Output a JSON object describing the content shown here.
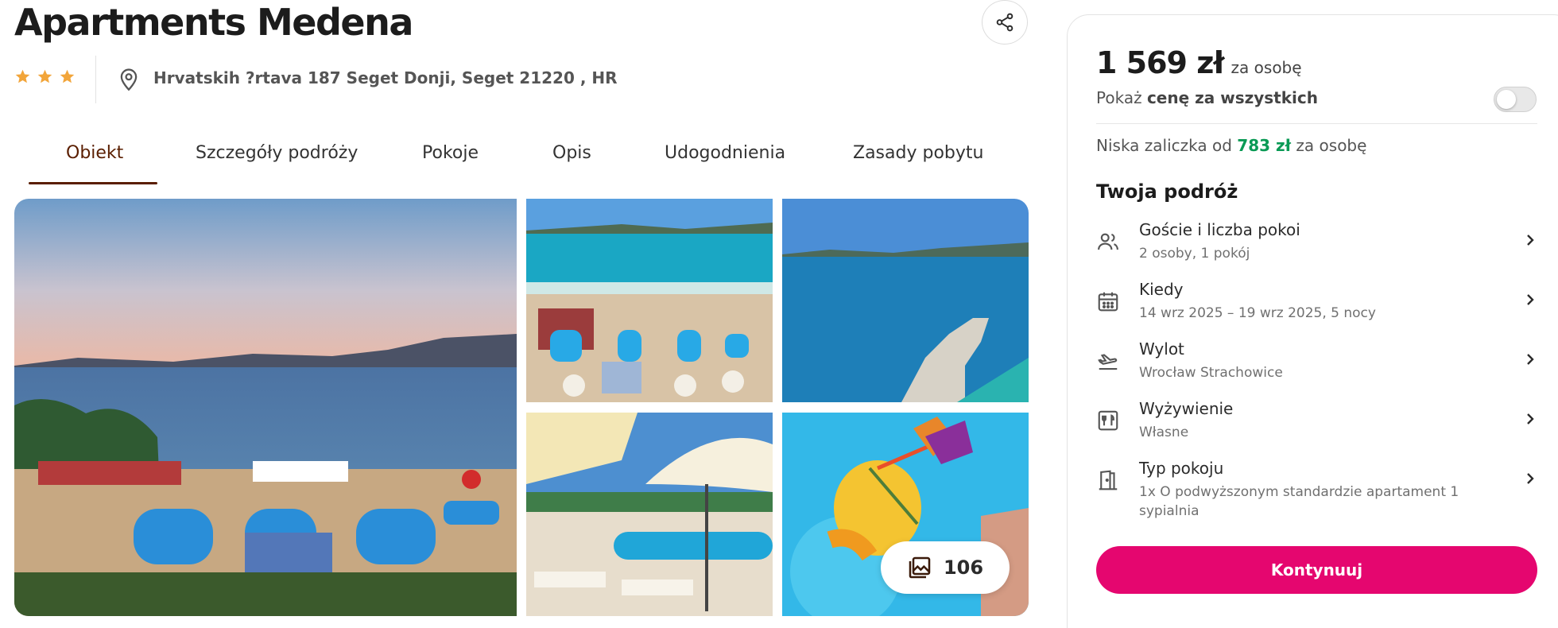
{
  "hotel": {
    "name": "Apartments Medena",
    "stars": 3,
    "address": "Hrvatskih ?rtava 187 Seget Donji, Seget 21220 , HR"
  },
  "tabs": [
    {
      "label": "Obiekt",
      "active": true
    },
    {
      "label": "Szczegóły podróży"
    },
    {
      "label": "Pokoje"
    },
    {
      "label": "Opis"
    },
    {
      "label": "Udogodnienia"
    },
    {
      "label": "Zasady pobytu"
    }
  ],
  "gallery": {
    "photo_count": "106",
    "photos": [
      "sunset-pool-terrace",
      "pool-aerial",
      "sea-pier",
      "umbrellas-pool",
      "cocktail"
    ]
  },
  "booking": {
    "price": "1 569 zł",
    "price_unit": "za osobę",
    "show_all_prefix": "Pokaż",
    "show_all_bold": "cenę za wszystkich",
    "toggle_on": false,
    "deposit_prefix": "Niska zaliczka od",
    "deposit_amount": "783 zł",
    "deposit_suffix": "za osobę",
    "trip_title": "Twoja podróż",
    "rows": [
      {
        "label": "Goście i liczba pokoi",
        "value": "2 osoby, 1 pokój",
        "icon": "guests-icon"
      },
      {
        "label": "Kiedy",
        "value": "14 wrz 2025 – 19 wrz 2025, 5 nocy",
        "icon": "calendar-icon"
      },
      {
        "label": "Wylot",
        "value": "Wrocław Strachowice",
        "icon": "plane-icon"
      },
      {
        "label": "Wyżywienie",
        "value": "Własne",
        "icon": "food-icon"
      },
      {
        "label": "Typ pokoju",
        "value": "1x O podwyższonym standardzie apartament 1 sypialnia",
        "icon": "door-icon"
      }
    ],
    "continue_label": "Kontynuuj"
  },
  "colors": {
    "accent": "#e5066f",
    "tab_active": "#5a1e00",
    "star": "#f2a53a",
    "deposit_green": "#0a9a55"
  }
}
